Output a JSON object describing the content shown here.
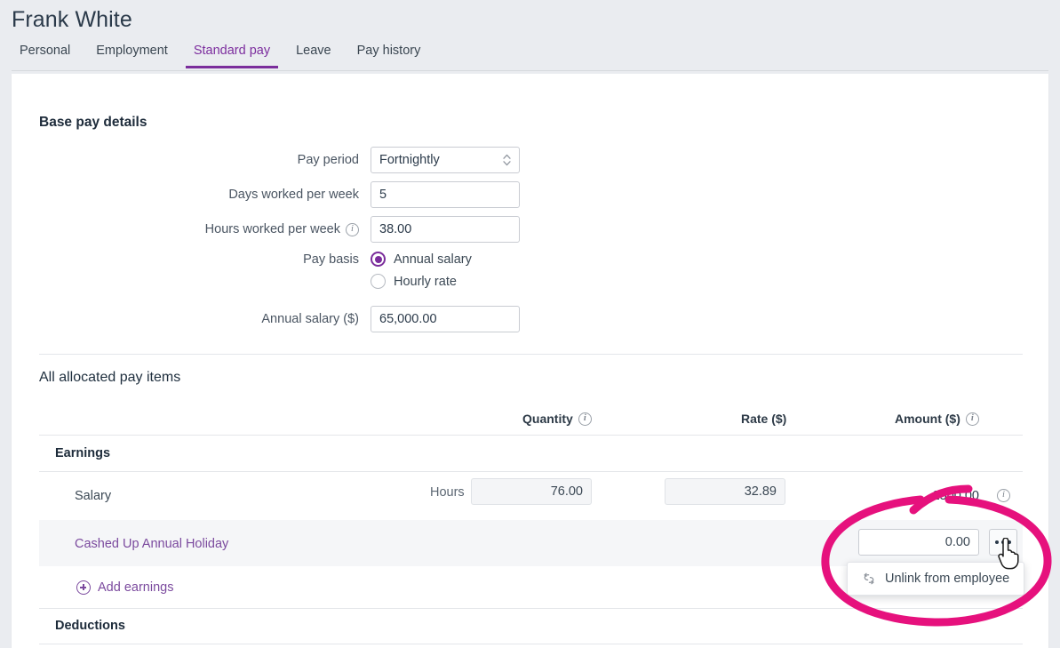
{
  "header": {
    "title": "Frank White",
    "tabs": [
      {
        "label": "Personal",
        "active": false
      },
      {
        "label": "Employment",
        "active": false
      },
      {
        "label": "Standard pay",
        "active": true
      },
      {
        "label": "Leave",
        "active": false
      },
      {
        "label": "Pay history",
        "active": false
      }
    ]
  },
  "base_pay": {
    "section_title": "Base pay details",
    "pay_period": {
      "label": "Pay period",
      "value": "Fortnightly"
    },
    "days_worked": {
      "label": "Days worked per week",
      "value": "5"
    },
    "hours_worked": {
      "label": "Hours worked per week",
      "value": "38.00",
      "info": "info-icon"
    },
    "pay_basis": {
      "label": "Pay basis",
      "options": [
        {
          "label": "Annual salary",
          "selected": true
        },
        {
          "label": "Hourly rate",
          "selected": false
        }
      ]
    },
    "annual_salary": {
      "label": "Annual salary ($)",
      "value": "65,000.00"
    }
  },
  "allocated": {
    "section_title": "All allocated pay items",
    "columns": {
      "quantity": "Quantity",
      "rate": "Rate ($)",
      "amount": "Amount ($)"
    },
    "groups": [
      {
        "name": "Earnings",
        "rows": [
          {
            "label": "Salary",
            "is_link": false,
            "quantity_unit": "Hours",
            "quantity": "76.00",
            "rate": "32.89",
            "amount": "2500.00",
            "amount_is_text": true,
            "has_info": true,
            "highlighted": false
          },
          {
            "label": "Cashed Up Annual Holiday",
            "is_link": true,
            "quantity_unit": "",
            "quantity": "",
            "rate": "",
            "amount": "0.00",
            "amount_is_text": false,
            "has_info": false,
            "highlighted": true
          }
        ],
        "add_link": "Add earnings"
      },
      {
        "name": "Deductions",
        "rows": [],
        "add_link": ""
      }
    ]
  },
  "context_menu": {
    "open": true,
    "items": [
      {
        "label": "Unlink from employee",
        "icon": "unlink-icon"
      }
    ]
  },
  "annotation": {
    "color": "#e6117d",
    "shape": "ellipse-with-arrow"
  },
  "colors": {
    "accent_purple": "#7b2d9c",
    "link_purple": "#7b4a9e",
    "annotation_pink": "#e6117d",
    "page_bg": "#eaecf0",
    "card_bg": "#ffffff"
  }
}
